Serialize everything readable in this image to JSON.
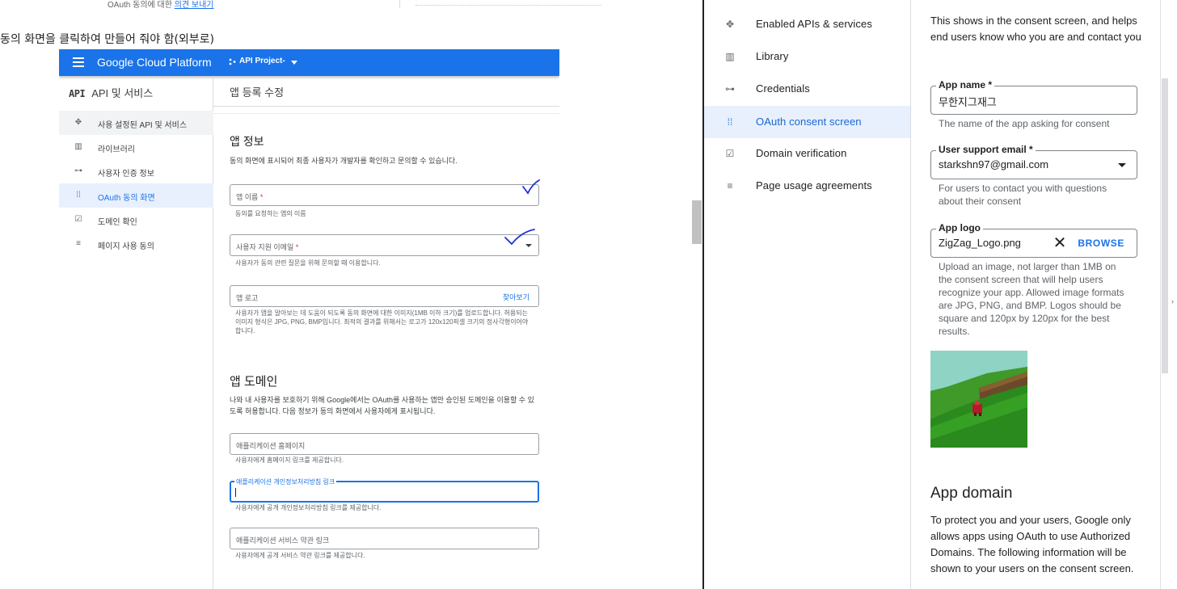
{
  "left": {
    "top_note_prefix": "OAuth 동의에 대한",
    "top_note_link": "의견 보내기",
    "caption": "동의 화면을 클릭하여 만들어 줘야 함(외부로)",
    "gcp": {
      "brand": "Google Cloud Platform",
      "project": "API Project-",
      "api_badge": "API",
      "api_title": "API 및 서비스",
      "page_title": "앱 등록 수정",
      "nav": [
        {
          "label": "사용 설정된 API 및 서비스",
          "icon": "diamond-arrows-icon"
        },
        {
          "label": "라이브러리",
          "icon": "library-icon"
        },
        {
          "label": "사용자 인증 정보",
          "icon": "key-icon"
        },
        {
          "label": "OAuth 동의 화면",
          "icon": "oauth-dots-icon"
        },
        {
          "label": "도메인 확인",
          "icon": "checkbox-icon"
        },
        {
          "label": "페이지 사용 동의",
          "icon": "settings-list-icon"
        }
      ],
      "app_info": {
        "title": "앱 정보",
        "desc": "동의 화면에 표시되어 최종 사용자가 개발자를 확인하고 문의할 수 있습니다.",
        "app_name_placeholder": "앱 이름",
        "app_name_hint": "동의를 요청하는 앱의 이름",
        "support_email_placeholder": "사용자 지원 이메일",
        "support_email_hint": "사용자가 동의 관련 질문을 위해 문의할 때 이용합니다.",
        "logo_placeholder": "앱 로고",
        "logo_browse": "찾아보기",
        "logo_hint": "사용자가 앱을 알아보는 데 도움이 되도록 동의 화면에 대한 이미지(1MB 이하 크기)를 업로드합니다. 허용되는 이미지 형식은 JPG, PNG, BMP입니다. 최적의 결과를 위해서는 로고가 120x120픽셀 크기의 정사각형이어야 합니다."
      },
      "app_domain": {
        "title": "앱 도메인",
        "desc": "나와 내 사용자를 보호하기 위해 Google에서는 OAuth를 사용하는 앱만 승인된 도메인을 이용할 수 있도록 허용합니다. 다음 정보가 동의 화면에서 사용자에게 표시됩니다.",
        "homepage_placeholder": "애플리케이션 홈페이지",
        "homepage_hint": "사용자에게 홈페이지 링크를 제공합니다.",
        "privacy_label": "애플리케이션 개인정보처리방침 링크",
        "privacy_hint": "사용자에게 공개 개인정보처리방침 링크를 제공합니다.",
        "tos_placeholder": "애플리케이션 서비스 약관 링크",
        "tos_hint": "사용자에게 공개 서비스 약관 링크를 제공합니다."
      }
    }
  },
  "right": {
    "nav": [
      {
        "label": "Enabled APIs & services",
        "icon": "diamond-arrows-icon"
      },
      {
        "label": "Library",
        "icon": "library-icon"
      },
      {
        "label": "Credentials",
        "icon": "key-icon"
      },
      {
        "label": "OAuth consent screen",
        "icon": "oauth-dots-icon"
      },
      {
        "label": "Domain verification",
        "icon": "checkbox-icon"
      },
      {
        "label": "Page usage agreements",
        "icon": "settings-list-icon"
      }
    ],
    "active_index": 3,
    "intro": "This shows in the consent screen, and helps end users know who you are and contact you",
    "app_name": {
      "label": "App name *",
      "value": "무한지그재그",
      "hint": "The name of the app asking for consent"
    },
    "support_email": {
      "label": "User support email *",
      "value": "starkshn97@gmail.com",
      "hint": "For users to contact you with questions about their consent"
    },
    "app_logo": {
      "label": "App logo",
      "value": "ZigZag_Logo.png",
      "browse": "BROWSE",
      "hint": "Upload an image, not larger than 1MB on the consent screen that will help users recognize your app. Allowed image formats are JPG, PNG, and BMP. Logos should be square and 120px by 120px for the best results."
    },
    "app_domain_title": "App domain",
    "app_domain_desc": "To protect you and your users, Google only allows apps using OAuth to use Authorized Domains. The following information will be shown to your users on the consent screen."
  },
  "colors": {
    "accent": "#1a73e8",
    "active_bg": "#e8f0fe",
    "check_ink": "#1f35d6"
  }
}
